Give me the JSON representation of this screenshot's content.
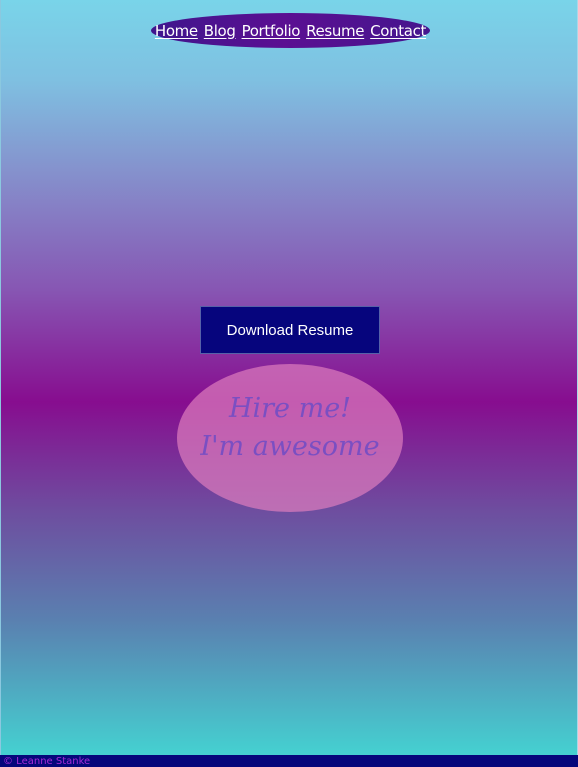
{
  "nav": {
    "items": [
      {
        "label": "Home"
      },
      {
        "label": "Blog"
      },
      {
        "label": "Portfolio"
      },
      {
        "label": "Resume"
      },
      {
        "label": "Contact"
      }
    ]
  },
  "main": {
    "download_label": "Download Resume",
    "hire_line_1": "Hire me!",
    "hire_line_2": "I'm awesome"
  },
  "footer": {
    "text": "© Leanne Stanke"
  },
  "colors": {
    "gradient_top": "#79d4e9",
    "gradient_middle": "#870d8f",
    "gradient_bottom": "#45cfd0",
    "nav_background": "#5b0f92",
    "button_background": "#06057d",
    "bubble_background": "#de7dbe",
    "hire_text": "#7a4fc2",
    "footer_background": "#05077b",
    "footer_text": "#a52ad6"
  }
}
